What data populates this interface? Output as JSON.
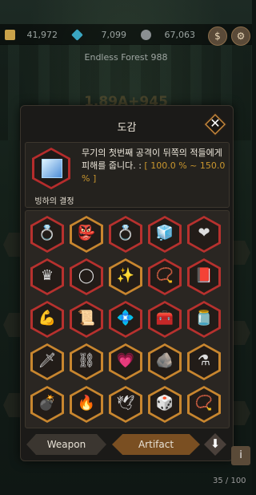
{
  "resources": [
    {
      "icon": "gold-bar-icon",
      "value": "41,972",
      "color": "#c9a24a"
    },
    {
      "icon": "blue-gem-icon",
      "value": "7,099",
      "color": "#3aa6c2"
    },
    {
      "icon": "stone-icon",
      "value": "67,063",
      "color": "#8a8f92"
    }
  ],
  "shop_button_glyph": "$",
  "settings_glyph": "⚙",
  "stage_name": "Endless Forest 988",
  "ghost_damage": "1.89A+945",
  "modal": {
    "title": "도감",
    "close_glyph": "✕",
    "selected": {
      "name": "빙하의 결정",
      "icon": "ice-cube-icon",
      "desc_line": "무기의 첫번째 공격이 뒤쪽의 적들에게 피해를 줍니다. :",
      "desc_pct": "[ 100.0 % ~ 150.0 % ]"
    },
    "artifacts": [
      {
        "icon": "diamond-ring-icon",
        "frame": "red",
        "glyph": "💍"
      },
      {
        "icon": "golden-mask-icon",
        "frame": "orange",
        "glyph": "👺"
      },
      {
        "icon": "sapphire-ring-icon",
        "frame": "red",
        "glyph": "💍"
      },
      {
        "icon": "ice-cube-icon",
        "frame": "red",
        "glyph": "🧊"
      },
      {
        "icon": "heart-icon",
        "frame": "red",
        "glyph": "❤"
      },
      {
        "icon": "dark-crown-icon",
        "frame": "red",
        "glyph": "♛"
      },
      {
        "icon": "bronze-ring-icon",
        "frame": "red",
        "glyph": "◯"
      },
      {
        "icon": "magic-wand-icon",
        "frame": "orange",
        "glyph": "✨"
      },
      {
        "icon": "amulet-icon",
        "frame": "red",
        "glyph": "📿"
      },
      {
        "icon": "spellbook-icon",
        "frame": "red",
        "glyph": "📕"
      },
      {
        "icon": "arm-plus-icon",
        "frame": "red",
        "glyph": "💪"
      },
      {
        "icon": "scroll-icon",
        "frame": "red",
        "glyph": "📜"
      },
      {
        "icon": "gem-circle-icon",
        "frame": "red",
        "glyph": "💠"
      },
      {
        "icon": "treasure-chest-icon",
        "frame": "red",
        "glyph": "🧰"
      },
      {
        "icon": "potion-jar-icon",
        "frame": "red",
        "glyph": "🫙"
      },
      {
        "icon": "green-blade-icon",
        "frame": "orange",
        "glyph": "🗡"
      },
      {
        "icon": "chain-icon",
        "frame": "orange",
        "glyph": "⛓"
      },
      {
        "icon": "heart-ring-icon",
        "frame": "orange",
        "glyph": "💗"
      },
      {
        "icon": "stone-tablet-icon",
        "frame": "orange",
        "glyph": "🪨"
      },
      {
        "icon": "blue-flask-icon",
        "frame": "orange",
        "glyph": "⚗"
      },
      {
        "icon": "skull-bomb-icon",
        "frame": "orange",
        "glyph": "💣"
      },
      {
        "icon": "torch-plus-icon",
        "frame": "orange",
        "glyph": "🔥"
      },
      {
        "icon": "crystal-wings-icon",
        "frame": "orange",
        "glyph": "🕊"
      },
      {
        "icon": "golden-dice-icon",
        "frame": "orange",
        "glyph": "🎲"
      },
      {
        "icon": "chain-necklace-icon",
        "frame": "orange",
        "glyph": "📿"
      }
    ],
    "tabs": {
      "weapon": "Weapon",
      "artifact": "Artifact"
    },
    "sort_glyph": "⬇"
  },
  "collection_count": "35 / 100",
  "info_glyph": "i"
}
